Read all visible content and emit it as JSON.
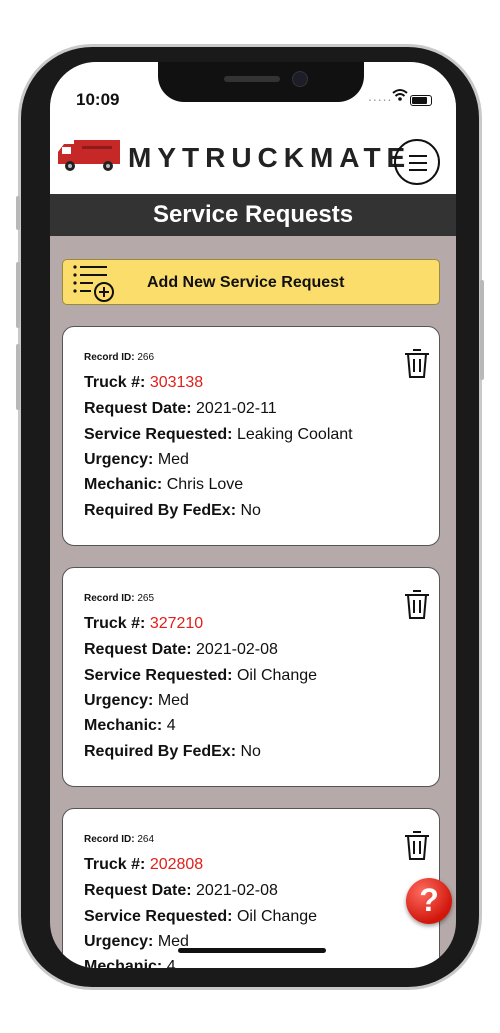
{
  "status_bar": {
    "time": "10:09",
    "signal": "....."
  },
  "header": {
    "brand": "MYTRUCKMATE"
  },
  "title": "Service Requests",
  "add_button": {
    "label": "Add New Service Request"
  },
  "labels": {
    "record_id": "Record ID:",
    "truck": "Truck #:",
    "request_date": "Request Date:",
    "service_requested": "Service Requested:",
    "urgency": "Urgency:",
    "mechanic": "Mechanic:",
    "required_by_fedex": "Required By FedEx:"
  },
  "records": [
    {
      "record_id": "266",
      "truck": "303138",
      "request_date": "2021-02-11",
      "service_requested": "Leaking Coolant",
      "urgency": "Med",
      "mechanic": "Chris Love",
      "required_by_fedex": "No"
    },
    {
      "record_id": "265",
      "truck": "327210",
      "request_date": "2021-02-08",
      "service_requested": "Oil Change",
      "urgency": "Med",
      "mechanic": "4",
      "required_by_fedex": "No"
    },
    {
      "record_id": "264",
      "truck": "202808",
      "request_date": "2021-02-08",
      "service_requested": "Oil Change",
      "urgency": "Med",
      "mechanic": "4"
    }
  ],
  "help": {
    "glyph": "?"
  },
  "colors": {
    "accent_yellow": "#fbdd6b",
    "truck_number_red": "#e0201b",
    "title_bar": "#333333",
    "background": "#b5a9aa"
  },
  "icons": {
    "menu": "hamburger-icon",
    "delete": "trash-icon",
    "add": "add-list-icon",
    "help": "help-icon"
  }
}
